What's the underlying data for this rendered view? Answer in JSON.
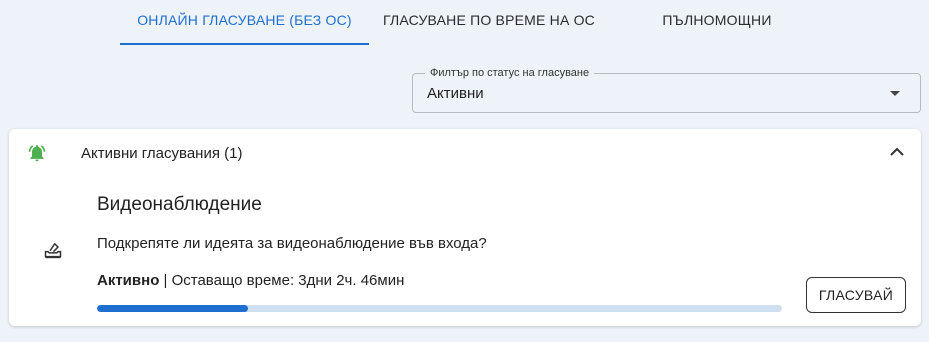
{
  "tabs": [
    {
      "label": "ОНЛАЙН ГЛАСУВАНЕ (БЕЗ ОС)",
      "active": true
    },
    {
      "label": "ГЛАСУВАНЕ ПО ВРЕМЕ НА ОС",
      "active": false
    },
    {
      "label": "ПЪЛНОМОЩНИ",
      "active": false
    }
  ],
  "filter": {
    "label": "Филтър по статус на гласуване",
    "value": "Активни"
  },
  "section": {
    "title": "Активни гласувания (1)",
    "expanded": true
  },
  "poll": {
    "title": "Видеонаблюдение",
    "question": "Подкрепяте ли идеята за видеонаблюдение във входа?",
    "status": "Активно",
    "separator": " | ",
    "remaining": "Оставащо време: 3дни 2ч. 46мин",
    "progress_fraction": 0.22,
    "vote_label": "ГЛАСУВАЙ"
  },
  "colors": {
    "accent": "#1f6fd1",
    "bell": "#4caf50",
    "background": "#eef3f9"
  },
  "icons": {
    "bell": "bell-ringing-icon",
    "ballot": "ballot-box-icon",
    "chevron": "chevron-up-icon",
    "caret": "caret-down-icon"
  }
}
